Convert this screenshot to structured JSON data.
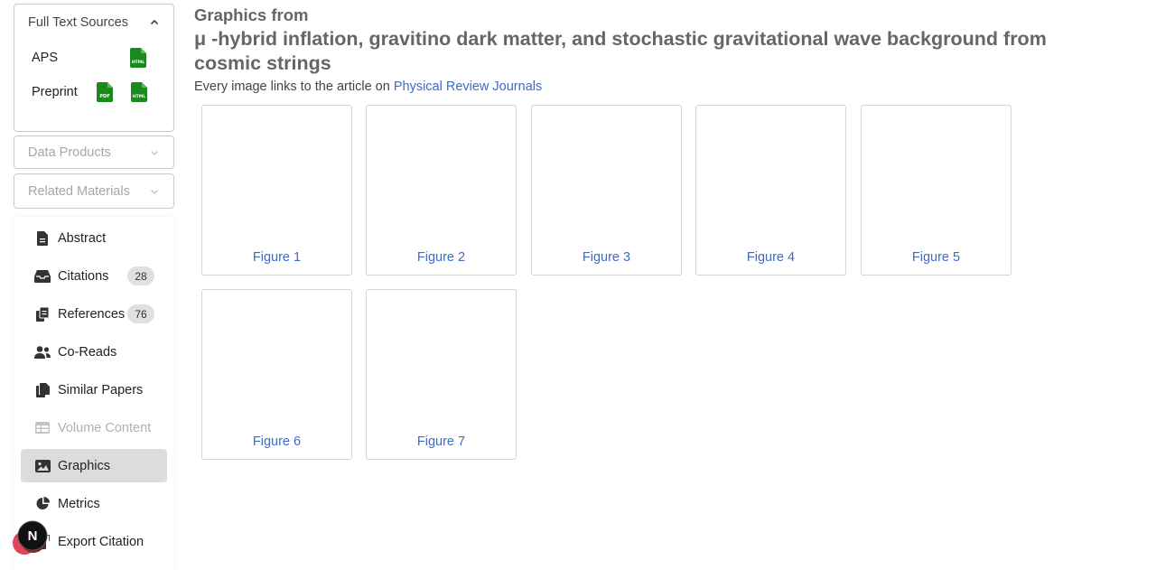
{
  "sidebar": {
    "full_text_sources": {
      "title": "Full Text Sources",
      "rows": [
        {
          "label": "APS",
          "files": [
            "HTML"
          ]
        },
        {
          "label": "Preprint",
          "files": [
            "PDF",
            "HTML"
          ]
        }
      ]
    },
    "data_products": {
      "title": "Data Products"
    },
    "related_materials": {
      "title": "Related Materials"
    },
    "nav": [
      {
        "label": "Abstract",
        "icon": "document-icon"
      },
      {
        "label": "Citations",
        "icon": "inbox-icon",
        "badge": "28"
      },
      {
        "label": "References",
        "icon": "copy-icon",
        "badge": "76"
      },
      {
        "label": "Co-Reads",
        "icon": "users-icon"
      },
      {
        "label": "Similar Papers",
        "icon": "papers-icon"
      },
      {
        "label": "Volume Content",
        "icon": "table-icon",
        "disabled": true
      },
      {
        "label": "Graphics",
        "icon": "image-icon",
        "active": true
      },
      {
        "label": "Metrics",
        "icon": "pie-chart-icon"
      },
      {
        "label": "Export Citation",
        "icon": "export-icon"
      }
    ],
    "logo_letter": "N"
  },
  "main": {
    "heading": "Graphics from",
    "title": "μ -hybrid inflation, gravitino dark matter, and stochastic gravitational wave background from cosmic strings",
    "note_prefix": "Every image links to the article on ",
    "note_link": "Physical Review Journals",
    "figures": [
      "Figure 1",
      "Figure 2",
      "Figure 3",
      "Figure 4",
      "Figure 5",
      "Figure 6",
      "Figure 7"
    ]
  },
  "colors": {
    "link": "#3f6bc4",
    "file_icon": "#1a8a1a",
    "active_bg": "#dcdcdc"
  }
}
